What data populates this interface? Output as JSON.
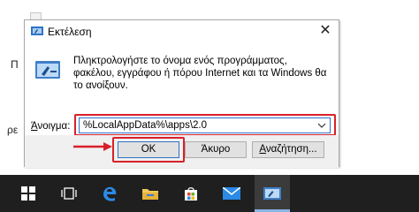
{
  "background": {
    "left_text_1": "Π",
    "left_text_2": "ρε"
  },
  "dialog": {
    "title": "Εκτέλεση",
    "close_glyph": "✕",
    "description": "Πληκτρολογήστε το όνομα ενός προγράμματος, φακέλου, εγγράφου ή πόρου Internet και τα Windows θα το ανοίξουν.",
    "open_label_prefix": "Ά",
    "open_label_rest": "νοιγμα:",
    "open_value": "%LocalAppData%\\apps\\2.0",
    "buttons": {
      "ok": "OK",
      "cancel": "Άκυρο",
      "browse_prefix": "Α",
      "browse_rest": "ναζήτηση..."
    }
  },
  "colors": {
    "highlight": "#d9202a",
    "accent": "#2f73c7",
    "taskbar": "#1f1f1f"
  },
  "taskbar": {
    "icons": [
      "windows-start-icon",
      "task-view-icon",
      "edge-icon",
      "file-explorer-icon",
      "store-icon",
      "mail-icon",
      "run-icon"
    ]
  }
}
